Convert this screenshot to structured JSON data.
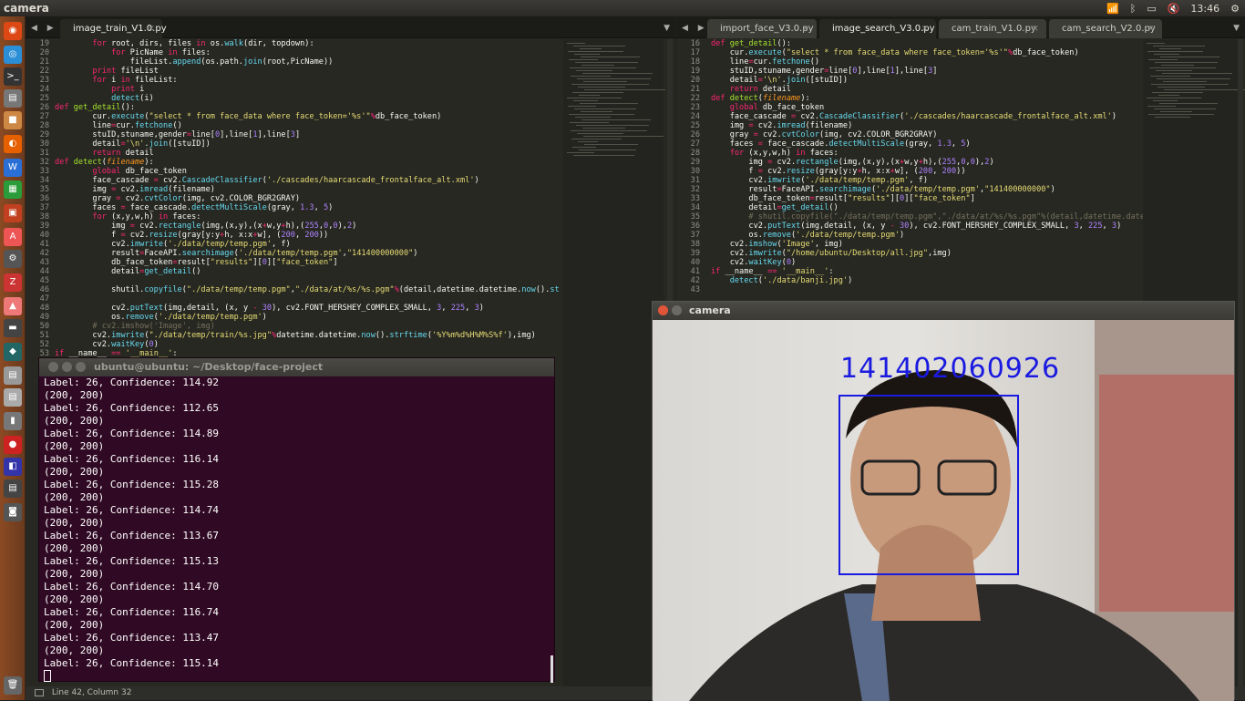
{
  "topbar": {
    "title": "camera",
    "time": "13:46"
  },
  "left_editor": {
    "tab": "image_train_V1.0.py",
    "first_line": 19
  },
  "right_editor": {
    "tabs": [
      "import_face_V3.0.py",
      "image_search_V3.0.py",
      "cam_train_V1.0.py",
      "cam_search_V2.0.py"
    ],
    "active_tab": 1,
    "first_line": 16
  },
  "terminal": {
    "title": "ubuntu@ubuntu: ~/Desktop/face-project",
    "lines": [
      "Label: 26, Confidence: 114.92",
      "(200, 200)",
      "Label: 26, Confidence: 112.65",
      "(200, 200)",
      "Label: 26, Confidence: 114.89",
      "(200, 200)",
      "Label: 26, Confidence: 116.14",
      "(200, 200)",
      "Label: 26, Confidence: 115.28",
      "(200, 200)",
      "Label: 26, Confidence: 114.74",
      "(200, 200)",
      "Label: 26, Confidence: 113.67",
      "(200, 200)",
      "Label: 26, Confidence: 115.13",
      "(200, 200)",
      "Label: 26, Confidence: 114.70",
      "(200, 200)",
      "Label: 26, Confidence: 116.74",
      "(200, 200)",
      "Label: 26, Confidence: 113.47",
      "(200, 200)",
      "Label: 26, Confidence: 115.14"
    ]
  },
  "camera": {
    "title": "camera",
    "label": "141402060926"
  },
  "statusbar": {
    "text": "Line 42, Column 32"
  }
}
